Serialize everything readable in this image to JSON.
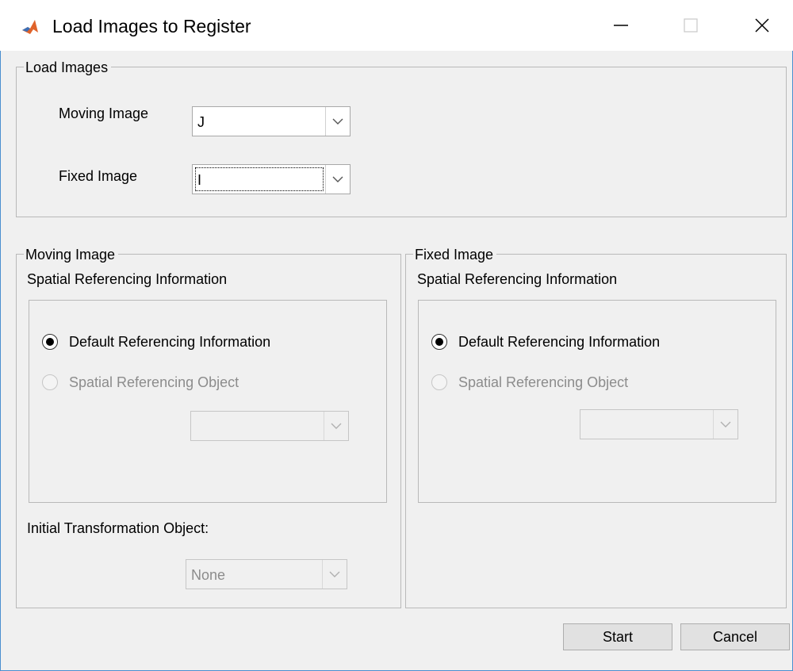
{
  "window": {
    "title": "Load Images to Register",
    "app_icon": "matlab-icon",
    "controls": [
      "minimize-icon",
      "maximize-icon",
      "close-icon"
    ]
  },
  "load_images": {
    "group_title": "Load Images",
    "moving_label": "Moving Image",
    "moving_value": "J",
    "fixed_label": "Fixed Image",
    "fixed_value": "I"
  },
  "moving_panel": {
    "group_title": "Moving Image",
    "section_label": "Spatial Referencing Information",
    "radio_default": "Default Referencing Information",
    "radio_object": "Spatial Referencing Object",
    "object_value": "",
    "tform_label": "Initial Transformation Object:",
    "tform_value": "None"
  },
  "fixed_panel": {
    "group_title": "Fixed Image",
    "section_label": "Spatial Referencing Information",
    "radio_default": "Default Referencing Information",
    "radio_object": "Spatial Referencing Object",
    "object_value": ""
  },
  "buttons": {
    "start": "Start",
    "cancel": "Cancel"
  },
  "colors": {
    "window_border": "#4a8fd0",
    "dialog_bg": "#f0f0f0",
    "disabled_text": "#8c8c8c"
  }
}
